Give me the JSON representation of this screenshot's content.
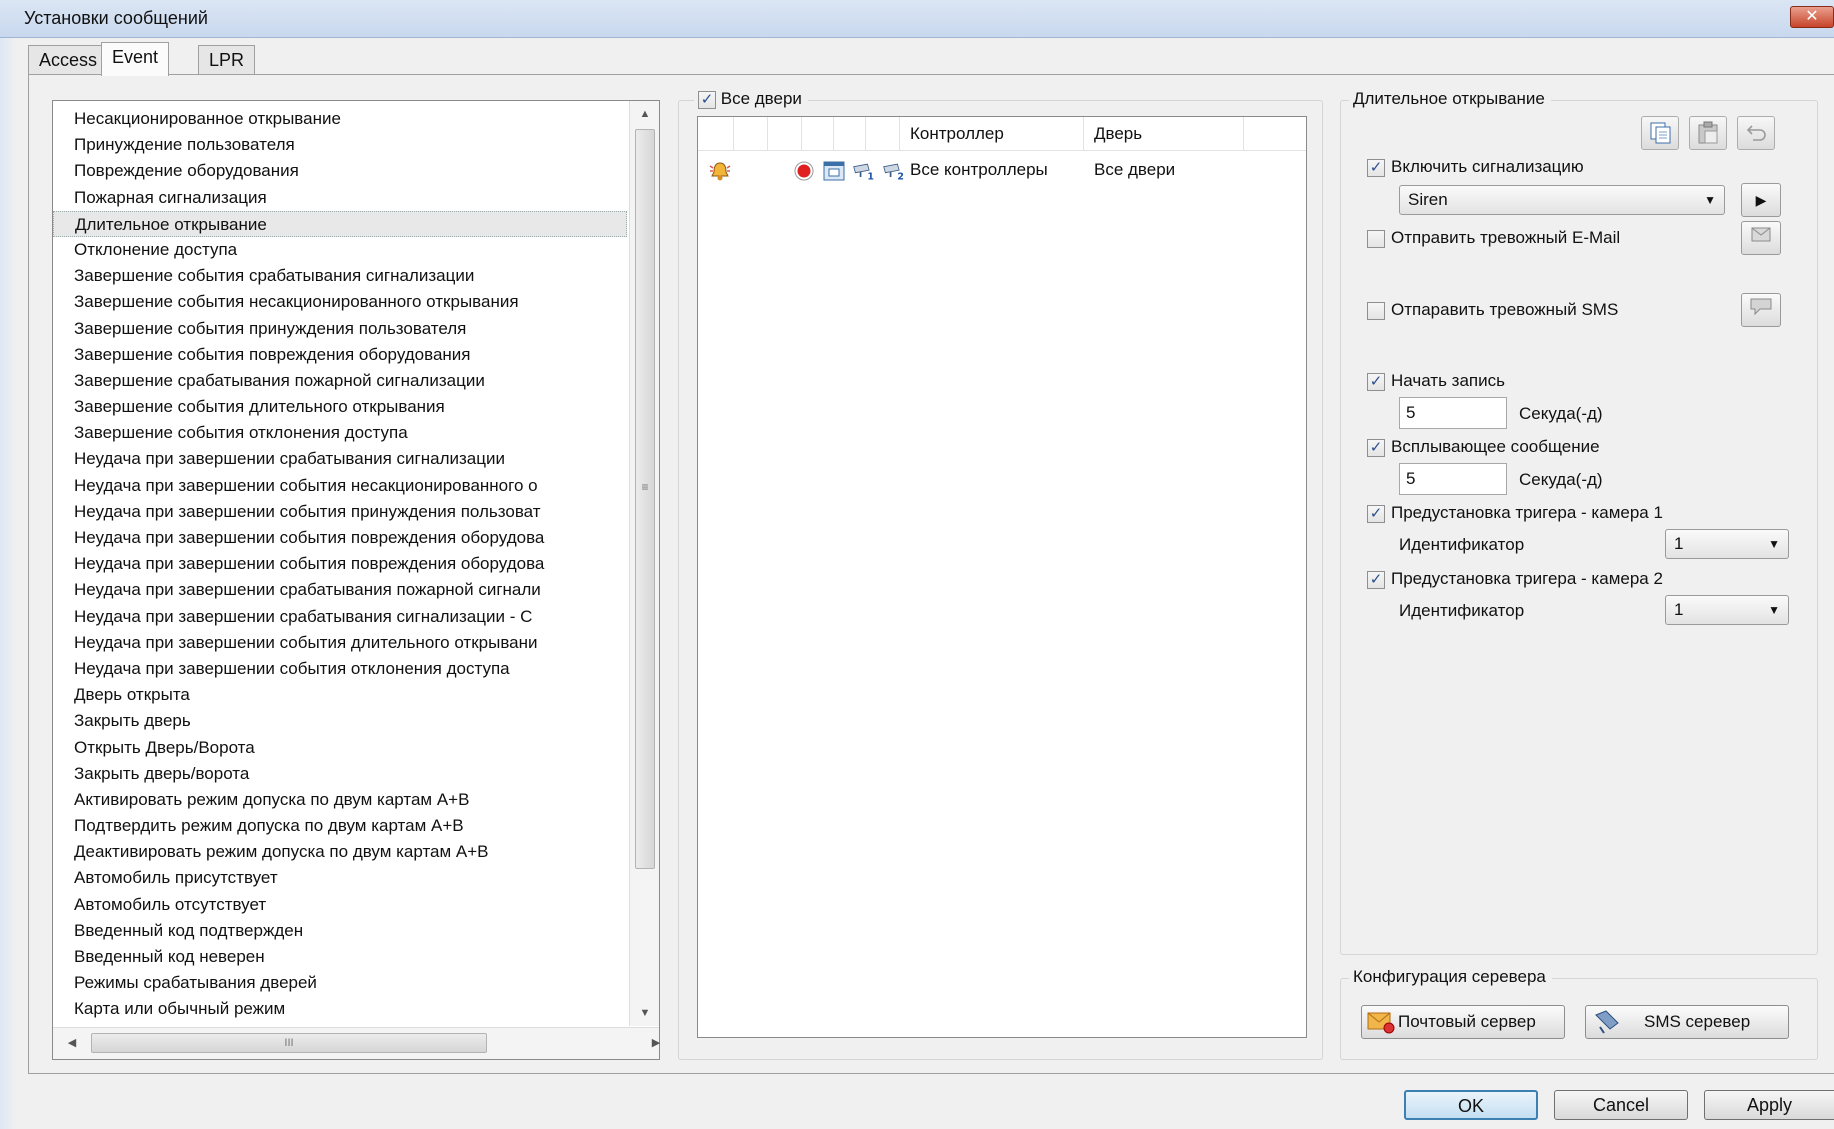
{
  "window": {
    "title": "Установки сообщений",
    "close_label": "✕"
  },
  "tabs": [
    {
      "label": "Access",
      "active": false
    },
    {
      "label": "Event",
      "active": true
    },
    {
      "label": "LPR",
      "active": false
    }
  ],
  "events": {
    "selected_index": 4,
    "items": [
      "Несакционированное открывание",
      "Принуждение пользователя",
      "Повреждение оборудования",
      "Пожарная сигнализация",
      "Длительное открывание",
      "Отклонение доступа",
      "Завершение события срабатывания сигнализации",
      "Завершение события несакционированного открывания",
      "Завершение события принуждения пользователя",
      "Завершение события повреждения оборудования",
      "Завершение срабатывания пожарной сигнализации",
      "Завершение события длительного открывания",
      "Завершение события отклонения доступа",
      "Неудача при завершении срабатывания сигнализации",
      "Неудача при завершении события несакционированного о",
      "Неудача при завершении события принуждения пользоват",
      "Неудача при завершении события повреждения оборудова",
      "Неудача при завершении события повреждения оборудова",
      "Неудача при завершении срабатывания пожарной сигнали",
      "Неудача при завершении срабатывания сигнализации - С",
      "Неудача при завершении события длительного открывани",
      "Неудача при завершении события отклонения доступа",
      "Дверь открыта",
      "Закрыть дверь",
      "Открыть Дверь/Ворота",
      "Закрыть дверь/ворота",
      "Активировать режим допуска по двум картам А+В",
      "Подтвердить режим допуска по двум картам А+В",
      "Деактивировать режим допуска по двум картам А+В",
      "Автомобиль присутствует",
      "Автомобиль отсутствует",
      "Введенный код подтвержден",
      "Введенный код неверен",
      "Режимы срабатывания дверей",
      "Карта или обычный режим"
    ],
    "hscroll_grip": "III"
  },
  "doors": {
    "all_doors_label": "Все двери",
    "all_doors_checked": true,
    "columns": {
      "controller": "Контроллер",
      "door": "Дверь"
    },
    "rows": [
      {
        "controller": "Все контроллеры",
        "door": "Все двери"
      }
    ]
  },
  "long_open": {
    "group_title": "Длительное открывание",
    "enable_alarm": {
      "label": "Включить сигнализацию",
      "checked": true
    },
    "sound": {
      "selected": "Siren"
    },
    "send_email": {
      "label": "Отправить тревожный E-Mail",
      "checked": false
    },
    "send_sms": {
      "label": "Отпаравить тревожный SMS",
      "checked": false
    },
    "start_record": {
      "label": "Начать запись",
      "checked": true,
      "value": "5",
      "unit": "Секуда(-д)"
    },
    "popup": {
      "label": "Всплывающее сообщение",
      "checked": true,
      "value": "5",
      "unit": "Секуда(-д)"
    },
    "preset_cam1": {
      "label": "Предустановка тригера - камера 1",
      "checked": true,
      "id_label": "Идентификатор",
      "id_value": "1"
    },
    "preset_cam2": {
      "label": "Предустановка тригера - камера 2",
      "checked": true,
      "id_label": "Идентификатор",
      "id_value": "1"
    }
  },
  "server_config": {
    "group_title": "Конфигурация серевера",
    "mail_button": "Почтовый сервер",
    "sms_button": "SMS серевер"
  },
  "dialog_buttons": {
    "ok": "OK",
    "cancel": "Cancel",
    "apply": "Apply"
  }
}
